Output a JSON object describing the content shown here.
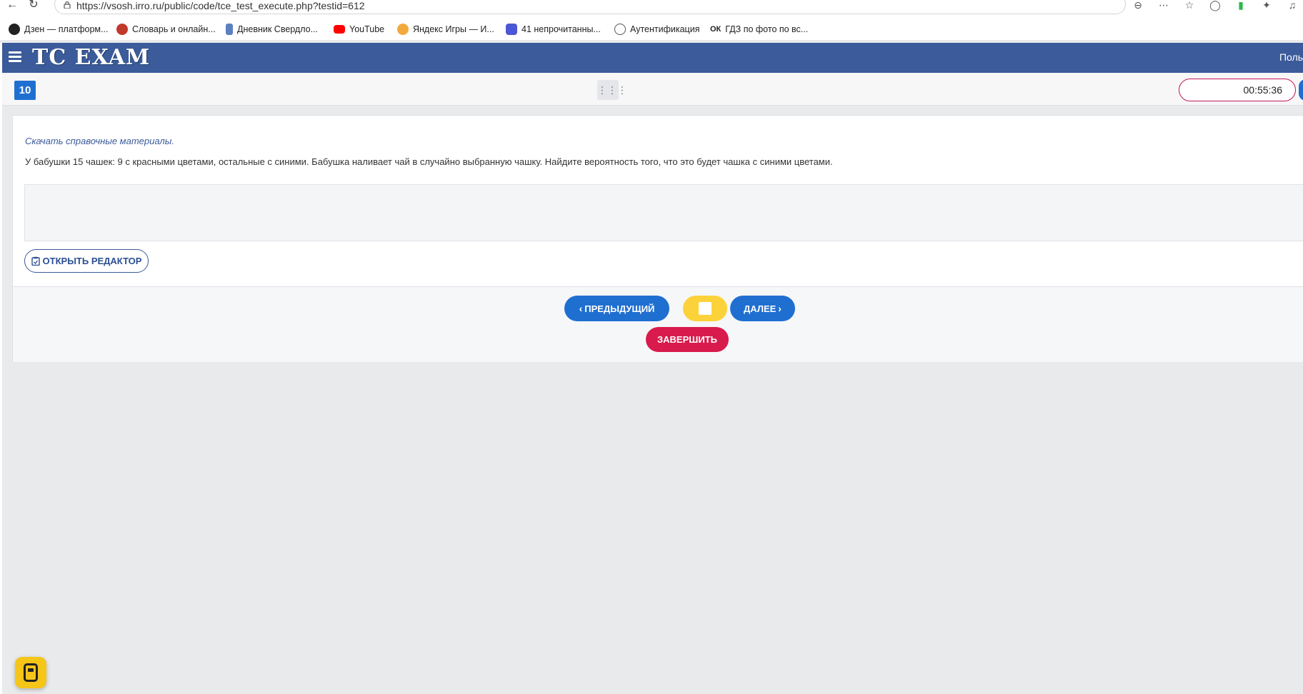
{
  "browser": {
    "url": "https://vsosh.irro.ru/public/code/tce_test_execute.php?testid=612",
    "bookmarks": [
      {
        "label": "Дзен — платформ...",
        "icon": "dzen-icon",
        "color": "#222222"
      },
      {
        "label": "Словарь и онлайн...",
        "icon": "dictionary-icon",
        "color": "#c0392b"
      },
      {
        "label": "Дневник Свердло...",
        "icon": "diary-icon",
        "color": "#5b7fbf"
      },
      {
        "label": "YouTube",
        "icon": "youtube-icon",
        "color": "#ff0000"
      },
      {
        "label": "Яндекс Игры — И...",
        "icon": "yandex-games-icon",
        "color": "#f2a93b"
      },
      {
        "label": "41 непрочитанны...",
        "icon": "mail-icon",
        "color": "#4a57d6"
      },
      {
        "label": "Аутентификация",
        "icon": "globe-icon",
        "color": "#555555"
      },
      {
        "label": "ГДЗ по фото по вс...",
        "icon": "ok-icon",
        "color": "#222222",
        "glyph": "ОК"
      }
    ]
  },
  "header": {
    "logo": "TC EXAM",
    "user": "Поль"
  },
  "toolbar": {
    "question_number": "10",
    "timer": "00:55:36"
  },
  "question": {
    "reference_link": "Скачать справочные материалы.",
    "text": "У бабушки 15 чашек: 9 с красными цветами, остальные с синими. Бабушка наливает чай в случайно выбранную чашку. Найдите вероятность того, что это будет чашка с синими цветами.",
    "open_editor_label": "ОТКРЫТЬ РЕДАКТОР"
  },
  "navigation": {
    "prev_label": "ПРЕДЫДУЩИЙ",
    "next_label": "ДАЛЕЕ",
    "finish_label": "ЗАВЕРШИТЬ"
  },
  "colors": {
    "header": "#3b5b9a",
    "primary": "#1f6fd1",
    "flag": "#fcd23a",
    "finish": "#d81b4c",
    "timer_border": "#c2185b"
  }
}
